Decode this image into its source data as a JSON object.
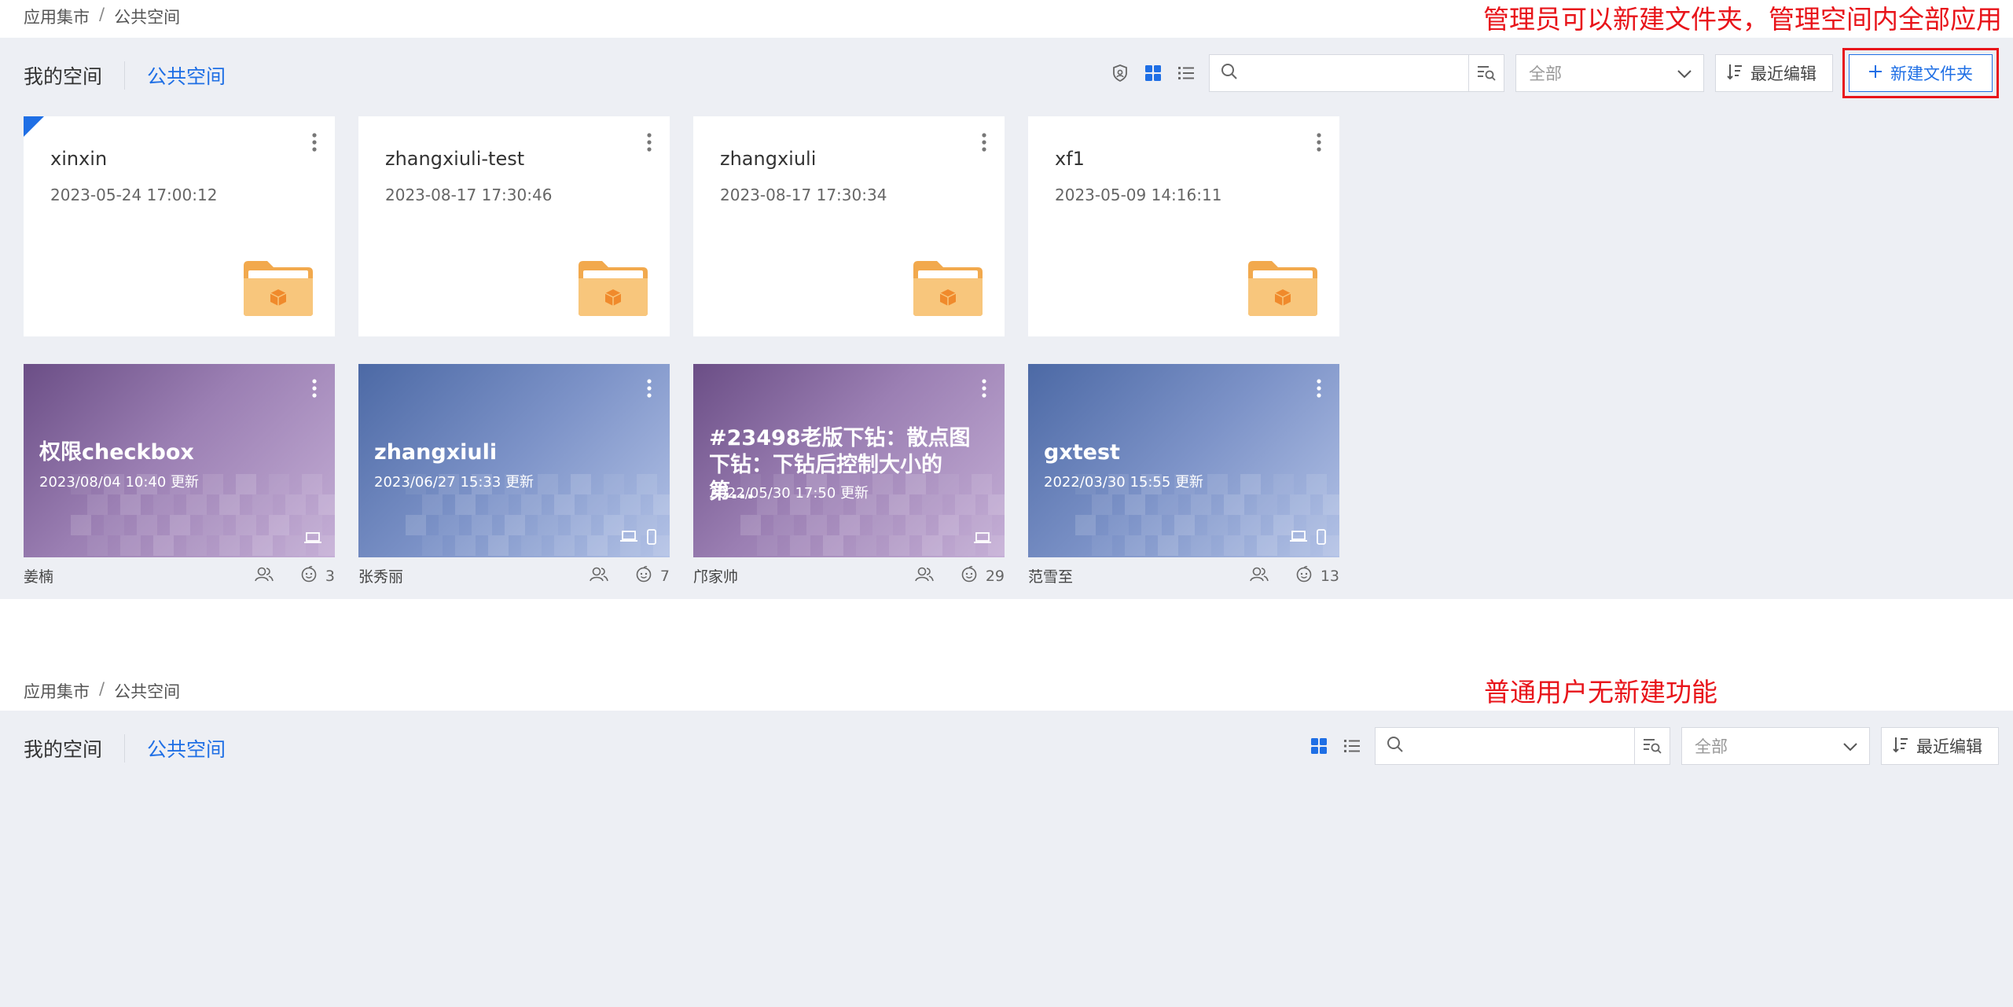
{
  "top": {
    "breadcrumb": [
      "应用集市",
      "公共空间"
    ],
    "annotation": "管理员可以新建文件夹，管理空间内全部应用",
    "tabs": [
      "我的空间",
      "公共空间"
    ],
    "select_value": "全部",
    "sort_label": "最近编辑",
    "new_folder_label": "新建文件夹",
    "folders": [
      {
        "name": "xinxin",
        "date": "2023-05-24 17:00:12",
        "selected": true
      },
      {
        "name": "zhangxiuli-test",
        "date": "2023-08-17 17:30:46",
        "selected": false
      },
      {
        "name": "zhangxiuli",
        "date": "2023-08-17 17:30:34",
        "selected": false
      },
      {
        "name": "xf1",
        "date": "2023-05-09 14:16:11",
        "selected": false
      }
    ],
    "apps": [
      {
        "title": "权限checkbox",
        "updated": "2023/08/04 10:40 更新",
        "owner": "姜楠",
        "count": "3",
        "theme": "purple",
        "devices": [
          "pc"
        ]
      },
      {
        "title": "zhangxiuli",
        "updated": "2023/06/27 15:33 更新",
        "owner": "张秀丽",
        "count": "7",
        "theme": "blue",
        "devices": [
          "pc",
          "mobile"
        ]
      },
      {
        "title": "#23498老版下钻：散点图下钻：下钻后控制大小的 第...",
        "updated": "2022/05/30 17:50 更新",
        "owner": "邝家帅",
        "count": "29",
        "theme": "purple",
        "devices": [
          "pc"
        ]
      },
      {
        "title": "gxtest",
        "updated": "2022/03/30 15:55 更新",
        "owner": "范雪至",
        "count": "13",
        "theme": "blue",
        "devices": [
          "pc",
          "mobile"
        ]
      }
    ]
  },
  "bottom": {
    "breadcrumb": [
      "应用集市",
      "公共空间"
    ],
    "annotation": "普通用户无新建功能",
    "tabs": [
      "我的空间",
      "公共空间"
    ],
    "select_value": "全部",
    "sort_label": "最近编辑"
  },
  "colors": {
    "accent": "#1f6fe5",
    "annotation": "#e8141a",
    "background": "#edeff4"
  }
}
